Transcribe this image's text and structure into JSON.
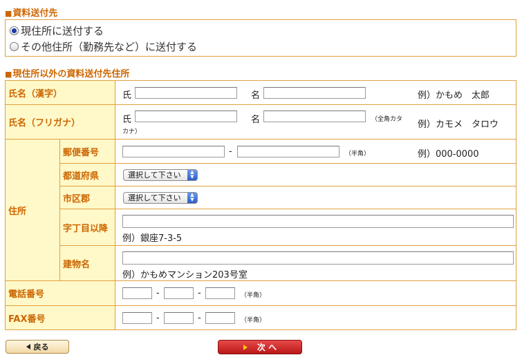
{
  "sections": {
    "destination_title": "資料送付先",
    "other_address_title": "現住所以外の資料送付先住所"
  },
  "radios": [
    {
      "label": "現住所に送付する",
      "checked": true
    },
    {
      "label": "その他住所（勤務先など）に送付する",
      "checked": false
    }
  ],
  "rows": {
    "name_kanji": {
      "label": "氏名（漢字）",
      "sei": "氏",
      "mei": "名",
      "example": "例）かもめ　太郎"
    },
    "name_kana": {
      "label": "氏名（フリガナ）",
      "sei": "氏",
      "mei": "名",
      "note_line1": "（全角カタ",
      "note_line2": "カナ）",
      "example": "例）カモメ　タロウ"
    },
    "address": {
      "label": "住所",
      "postal": {
        "label": "郵便番号",
        "sep": "-",
        "note": "（半角）",
        "example": "例）000-0000"
      },
      "prefecture": {
        "label": "都道府県",
        "select": "選択して下さい"
      },
      "city": {
        "label": "市区郡",
        "select": "選択して下さい"
      },
      "street": {
        "label": "字丁目以降",
        "example": "例）銀座7-3-5"
      },
      "building": {
        "label": "建物名",
        "example": "例）かもめマンション203号室"
      }
    },
    "phone": {
      "label": "電話番号",
      "sep1": "-",
      "sep2": "-",
      "note": "（半角）"
    },
    "fax": {
      "label": "FAX番号",
      "sep1": "-",
      "sep2": "-",
      "note": "（半角）"
    }
  },
  "buttons": {
    "back": "戻る",
    "next": "次 へ"
  },
  "colors": {
    "accent": "#cc6600",
    "border": "#e0a040",
    "label_bg": "#fff8c8",
    "next_button": "#c82020"
  }
}
